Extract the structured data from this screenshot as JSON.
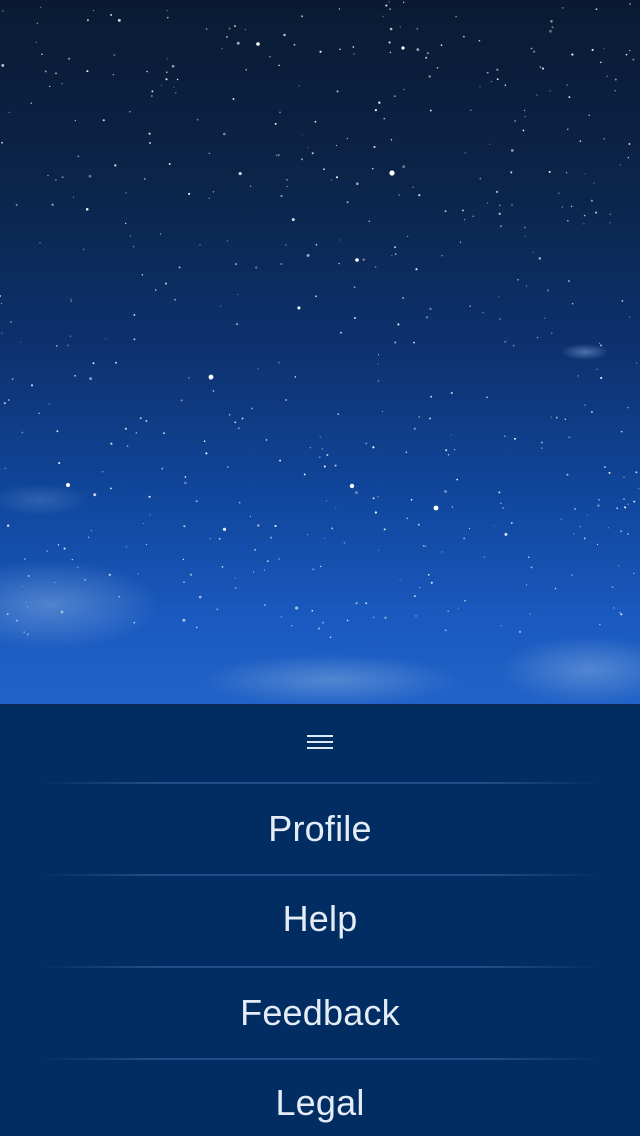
{
  "colors": {
    "panel_background": "#022d62",
    "menu_text": "#e4ecf7",
    "sky_top": "#0a1a33",
    "sky_bottom": "#2163c8"
  },
  "background": {
    "icon": "starry-night-sky"
  },
  "menu": {
    "handle_icon": "hamburger-icon",
    "items": [
      {
        "label": "Profile"
      },
      {
        "label": "Help"
      },
      {
        "label": "Feedback"
      },
      {
        "label": "Legal"
      }
    ]
  }
}
